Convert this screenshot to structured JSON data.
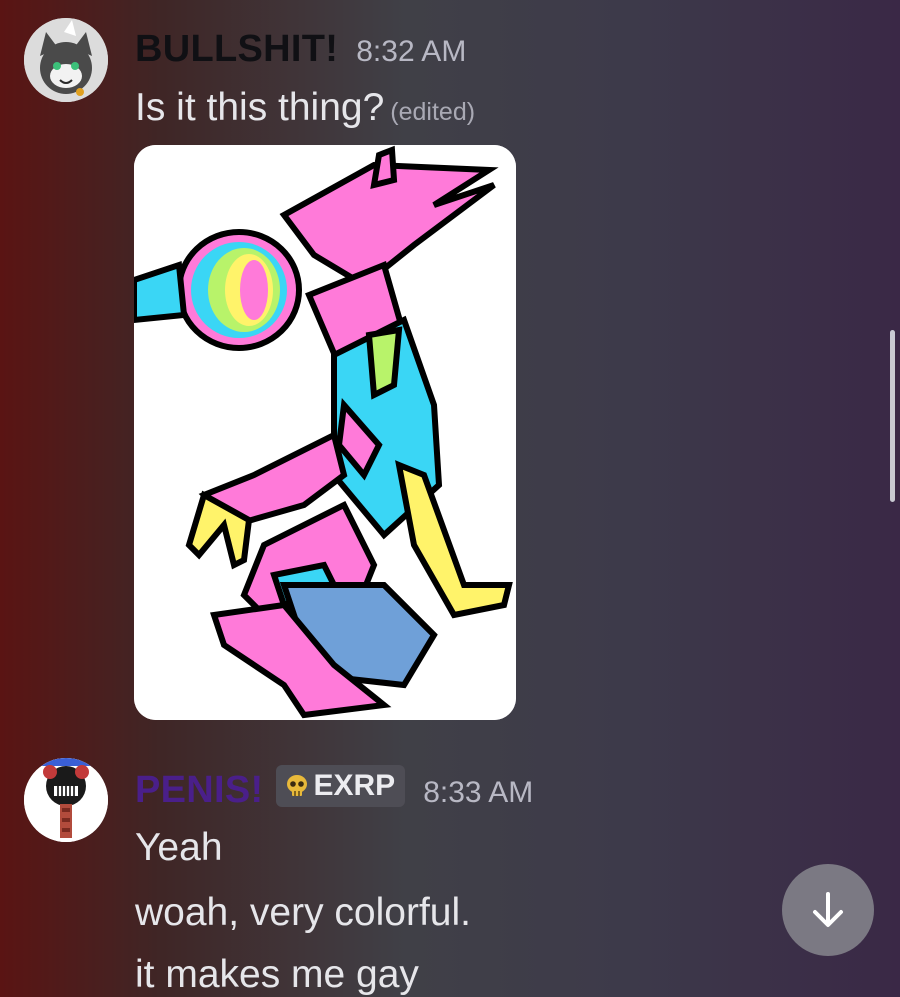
{
  "messages": [
    {
      "username": "BULLSHIT!",
      "username_color": "#101014",
      "timestamp": "8:32 AM",
      "text": "Is it this thing?",
      "edited_label": "(edited)",
      "attachment": "pixel-art-figure-image"
    },
    {
      "username": "PENIS!",
      "username_color": "#4a1f8a",
      "tag": {
        "icon": "skull-icon",
        "label": "EXRP"
      },
      "timestamp": "8:33 AM",
      "lines": [
        "Yeah",
        "woah, very colorful.",
        "it makes me gay"
      ]
    }
  ],
  "jump_button": {
    "icon": "arrow-down-icon"
  }
}
